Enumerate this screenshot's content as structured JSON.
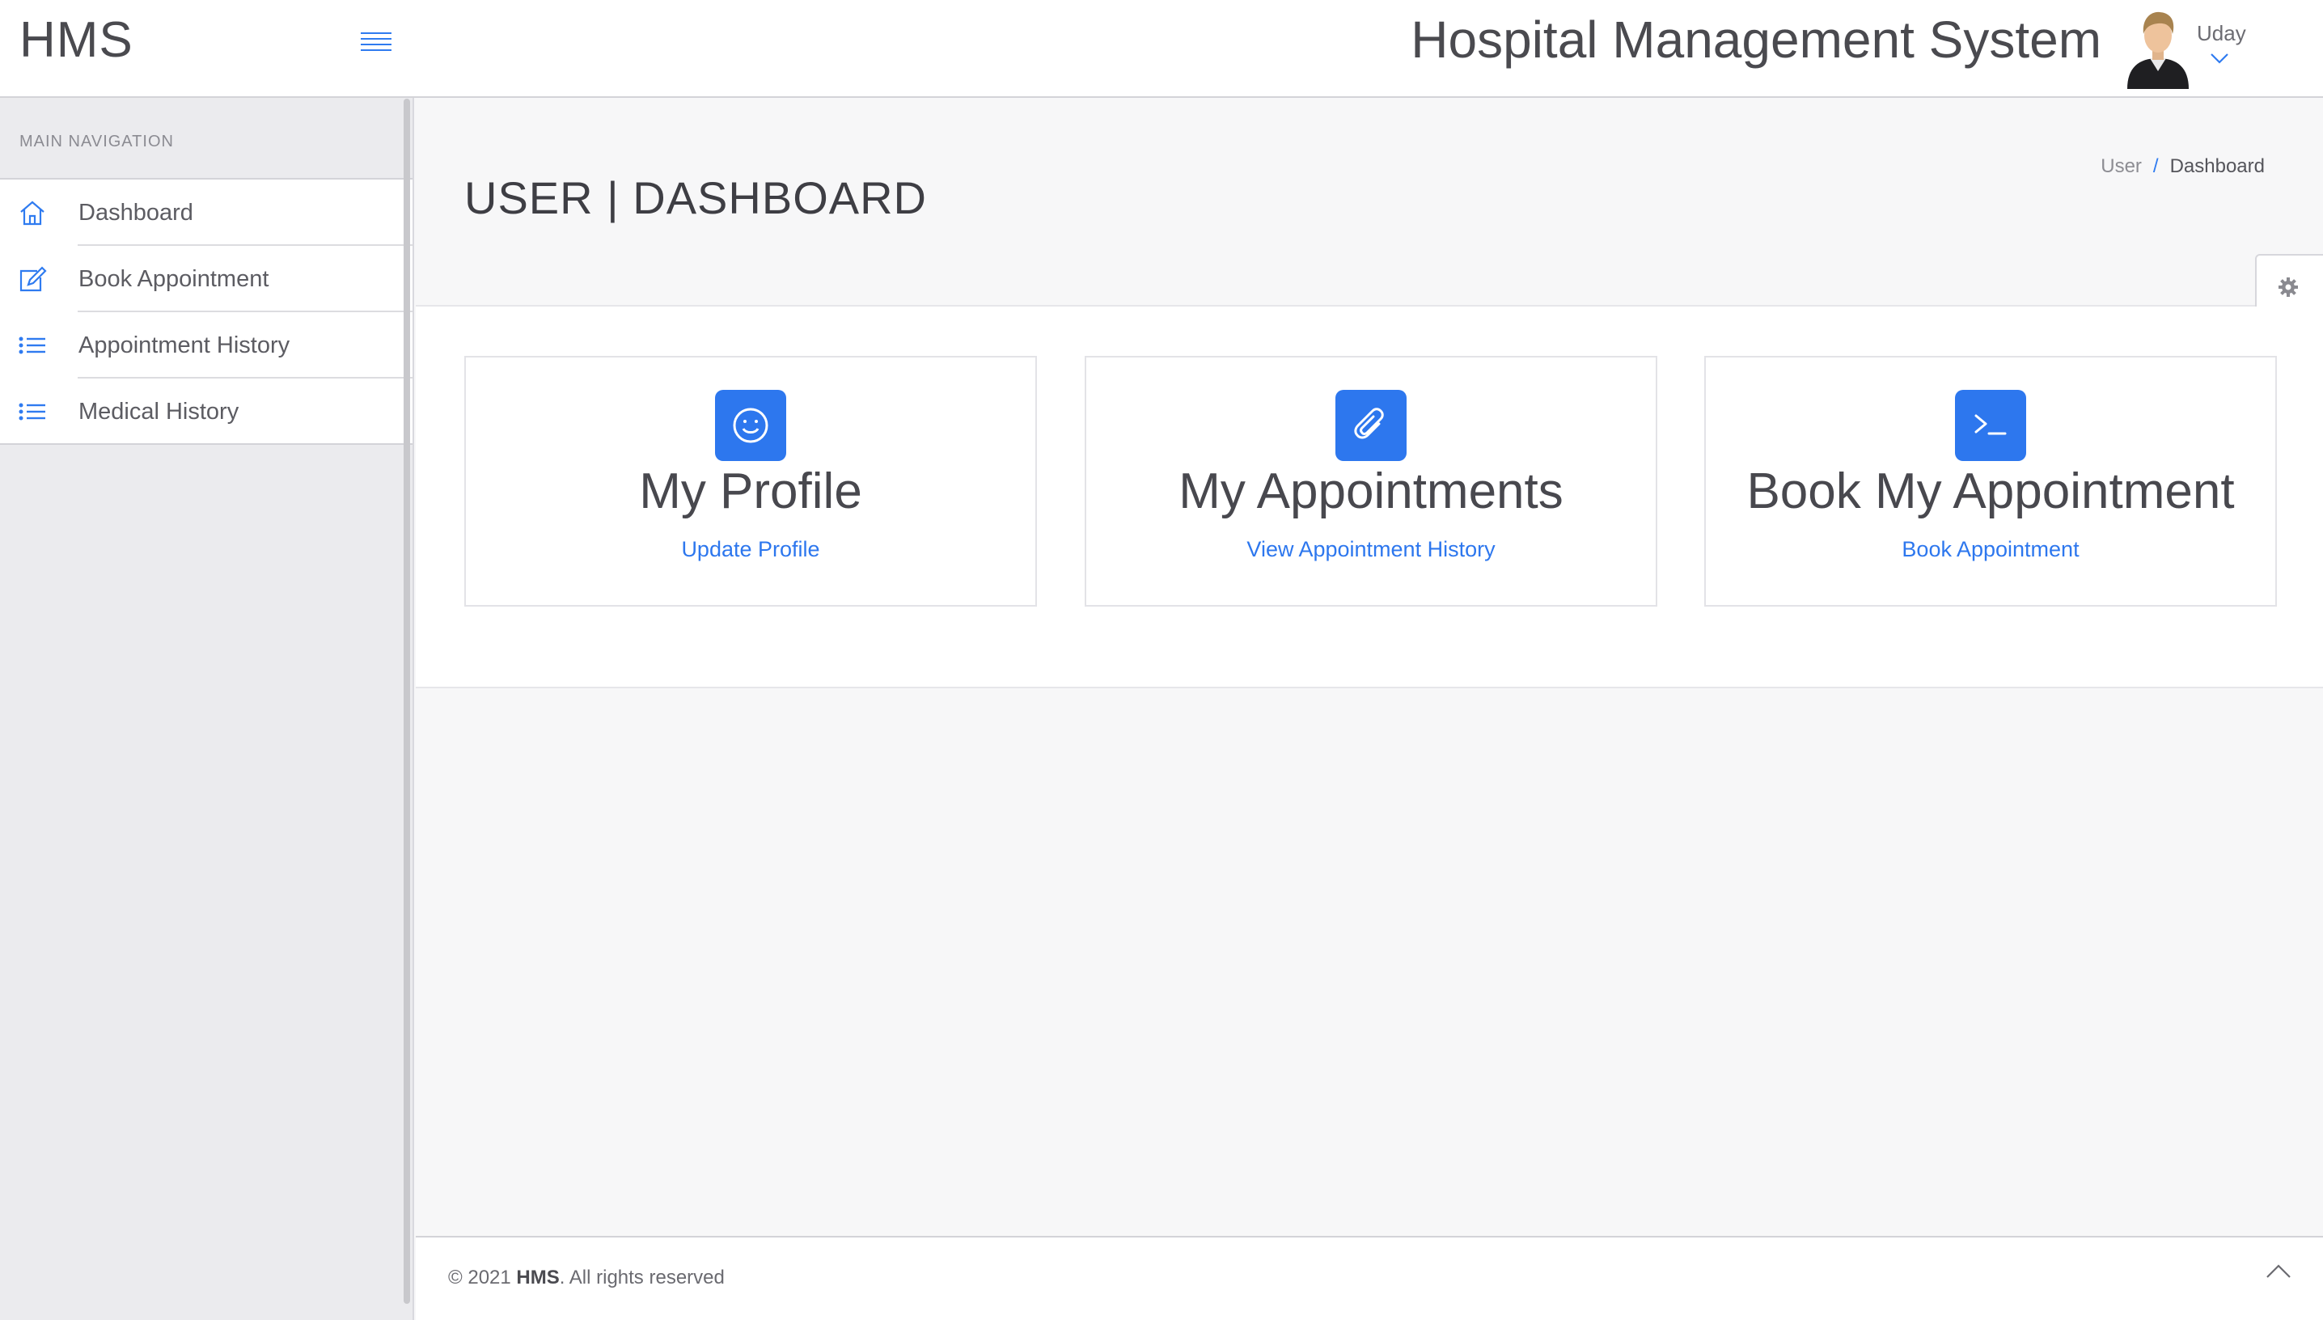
{
  "brand": "HMS",
  "header": {
    "title": "Hospital Management System",
    "user_name": "Uday"
  },
  "sidebar": {
    "heading": "MAIN NAVIGATION",
    "items": [
      {
        "label": "Dashboard",
        "icon": "home-icon"
      },
      {
        "label": "Book Appointment",
        "icon": "edit-icon"
      },
      {
        "label": "Appointment History",
        "icon": "list-icon"
      },
      {
        "label": "Medical History",
        "icon": "list-icon"
      }
    ]
  },
  "page": {
    "title": "USER | DASHBOARD",
    "breadcrumb": [
      "User",
      "/",
      "Dashboard"
    ]
  },
  "cards": [
    {
      "title": "My Profile",
      "link": "Update Profile",
      "icon": "smiley-icon"
    },
    {
      "title": "My Appointments",
      "link": "View Appointment History",
      "icon": "paperclip-icon"
    },
    {
      "title": "Book My Appointment",
      "link": "Book Appointment",
      "icon": "terminal-icon"
    }
  ],
  "footer": {
    "prefix": "© 2021 ",
    "brand": "HMS",
    "suffix": ". All rights reserved"
  },
  "colors": {
    "accent": "#2d77ee",
    "sidebar_bg": "#ebebee",
    "page_bg": "#f7f7f8"
  }
}
